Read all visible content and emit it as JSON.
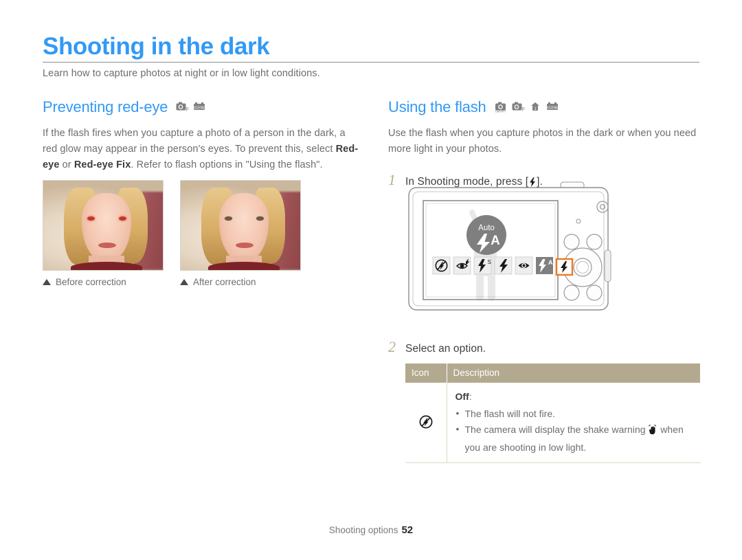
{
  "document": {
    "title": "Shooting in the dark",
    "lede": "Learn how to capture photos at night or in low light conditions.",
    "footer_section": "Shooting options",
    "footer_page": "52",
    "accent_color": "#3399f5",
    "table_header_color": "#b3a98f",
    "step_number_color": "#b8ae95"
  },
  "left_column": {
    "section_title": "Preventing red-eye",
    "mode_icons": [
      "program-mode-icon",
      "scene-mode-icon"
    ],
    "paragraph_part1": "If the flash fires when you capture a photo of a person in the dark, a red glow may appear in the person's eyes. To prevent this, select ",
    "bold1": "Red-eye",
    "paragraph_part2": " or ",
    "bold2": "Red-eye Fix",
    "paragraph_part3": ". Refer to flash options in \"Using the flash\".",
    "photos": [
      {
        "caption": "Before correction",
        "state": "red-eye"
      },
      {
        "caption": "After correction",
        "state": "corrected"
      }
    ]
  },
  "right_column": {
    "section_title": "Using the flash",
    "mode_icons": [
      "smart-auto-mode-icon",
      "program-mode-icon",
      "dual-is-mode-icon",
      "scene-mode-icon"
    ],
    "intro": "Use the flash when you capture photos in the dark or when you need more light in your photos.",
    "step1": {
      "number": "1",
      "text_before": "In Shooting mode, press [",
      "text_after": "]."
    },
    "step2": {
      "number": "2",
      "text": "Select an option."
    },
    "camera": {
      "lcd_overlay_label": "Auto",
      "lcd_overlay_icon": "flash-auto-icon",
      "flash_option_icons": [
        "flash-off-icon",
        "flash-red-eye-fix-icon",
        "flash-slow-sync-icon",
        "flash-fill-in-icon",
        "flash-red-eye-icon",
        "flash-auto-icon"
      ],
      "selected_option_index": 5,
      "highlighted_button": "flash-button",
      "highlight_color": "#f07820"
    },
    "table": {
      "headers": [
        "Icon",
        "Description"
      ],
      "rows": [
        {
          "icon": "flash-off-icon",
          "name": "Off",
          "name_suffix": ":",
          "bullets": [
            "The flash will not fire.",
            "The camera will display the shake warning � when you are shooting in low light."
          ],
          "bullet2_before": "The camera will display the shake warning ",
          "bullet2_after": " when you are shooting in low light.",
          "bullet2_icon": "shake-warning-icon"
        }
      ]
    }
  }
}
